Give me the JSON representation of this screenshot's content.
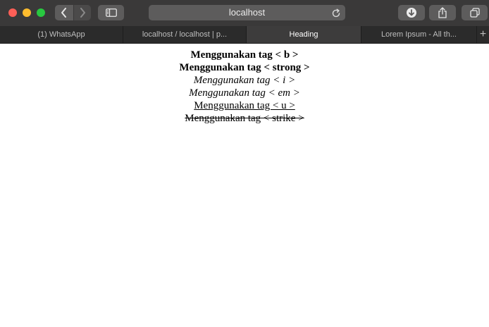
{
  "browser": {
    "address": "localhost",
    "tabs": [
      {
        "label": "(1) WhatsApp",
        "active": false
      },
      {
        "label": "localhost / localhost | p...",
        "active": false
      },
      {
        "label": "Heading",
        "active": true
      },
      {
        "label": "Lorem Ipsum - All th...",
        "active": false
      }
    ],
    "new_tab_label": "+"
  },
  "icons": {
    "close": "close-traffic-light",
    "minimize": "minimize-traffic-light",
    "maximize": "maximize-traffic-light",
    "back": "chevron-left-icon",
    "forward": "chevron-right-icon",
    "sidebar": "sidebar-icon",
    "reload": "reload-icon",
    "download": "download-icon",
    "share": "share-icon",
    "tabs": "tab-overview-icon"
  },
  "colors": {
    "close": "#fe5f57",
    "minimize": "#febc2e",
    "maximize": "#28c840",
    "toolbar": "#3a3939",
    "tabbar": "#2b2b2b"
  },
  "page": {
    "lines": [
      "Menggunakan tag < b >",
      "Menggunakan tag < strong >",
      "Menggunakan tag < i >",
      "Menggunakan tag < em >",
      "Menggunakan tag < u >",
      "Menggunakan tag < strike >"
    ]
  }
}
